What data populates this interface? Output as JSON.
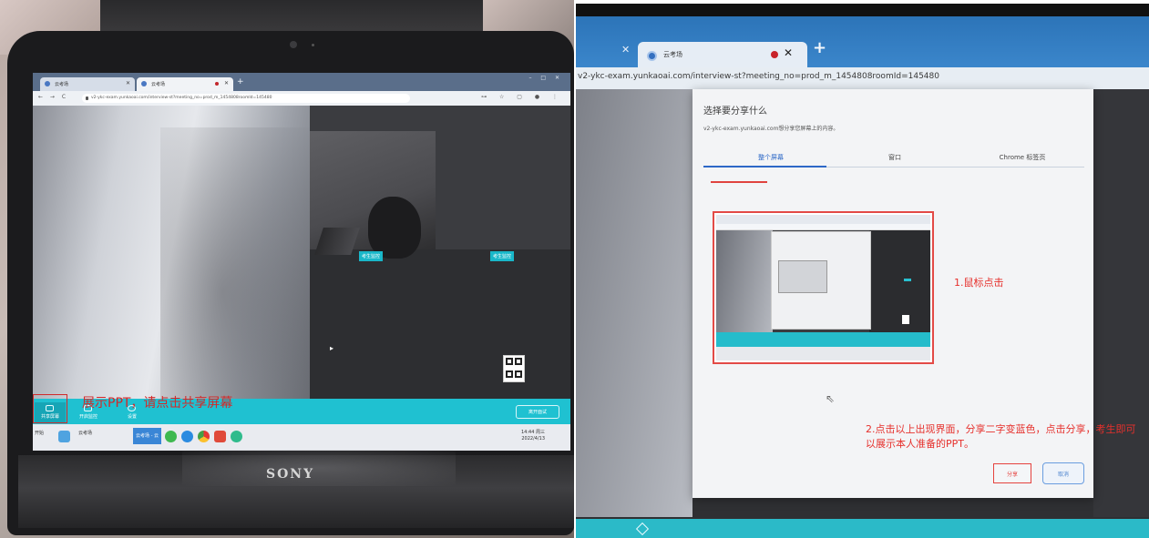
{
  "left_photo": {
    "brand": "SONY",
    "browser": {
      "tabs": [
        {
          "label": "云考场"
        },
        {
          "label": "云考场"
        }
      ],
      "new_tab": "+",
      "window_controls": "– □ ✕",
      "nav": "← → C",
      "url": "v2-ykc-exam.yunkaoai.com/interview-st?meeting_no=prod_m_1454808roomId=145480",
      "extensions": "⊶ ☆ ▢ ● ⋮"
    },
    "video_tags": {
      "left": "考生监控",
      "right": "考生监控"
    },
    "toolbar": {
      "items": [
        {
          "label": "共享屏幕",
          "selected": true
        },
        {
          "label": "开启监控",
          "selected": false
        },
        {
          "label": "设置",
          "selected": false
        }
      ],
      "exit_label": "离开面试"
    },
    "annotation": "展示PPT，请点击共享屏幕",
    "taskbar": {
      "start_label": "开始",
      "app_label": "云考场",
      "active_label": "云考场 - 云",
      "clock_line1": "14:44 周三",
      "clock_line2": "2022/4/13"
    }
  },
  "right_screenshot": {
    "browser": {
      "tab_close": "✕",
      "tab_label": "云考场",
      "tab_close_active": "✕",
      "new_tab": "+",
      "url": "v2-ykc-exam.yunkaoai.com/interview-st?meeting_no=prod_m_1454808roomId=145480"
    },
    "dialog": {
      "title": "选择要分享什么",
      "subtitle": "v2-ykc-exam.yunkaoai.com想分享您屏幕上的内容。",
      "tabs": [
        {
          "label": "整个屏幕",
          "active": true
        },
        {
          "label": "窗口",
          "active": false
        },
        {
          "label": "Chrome 标签页",
          "active": false
        }
      ],
      "annotation_1": "1.鼠标点击",
      "annotation_2": "2.点击以上出现界面，分享二字变蓝色，点击分享，考生即可以展示本人准备的PPT。",
      "share_button": "分享",
      "cancel_button": "取消"
    }
  },
  "colors": {
    "accent_teal": "#1fc1d1",
    "annotation_red": "#e6302c",
    "chrome_blue": "#2c74b8",
    "dialog_blue": "#2d68c7"
  }
}
